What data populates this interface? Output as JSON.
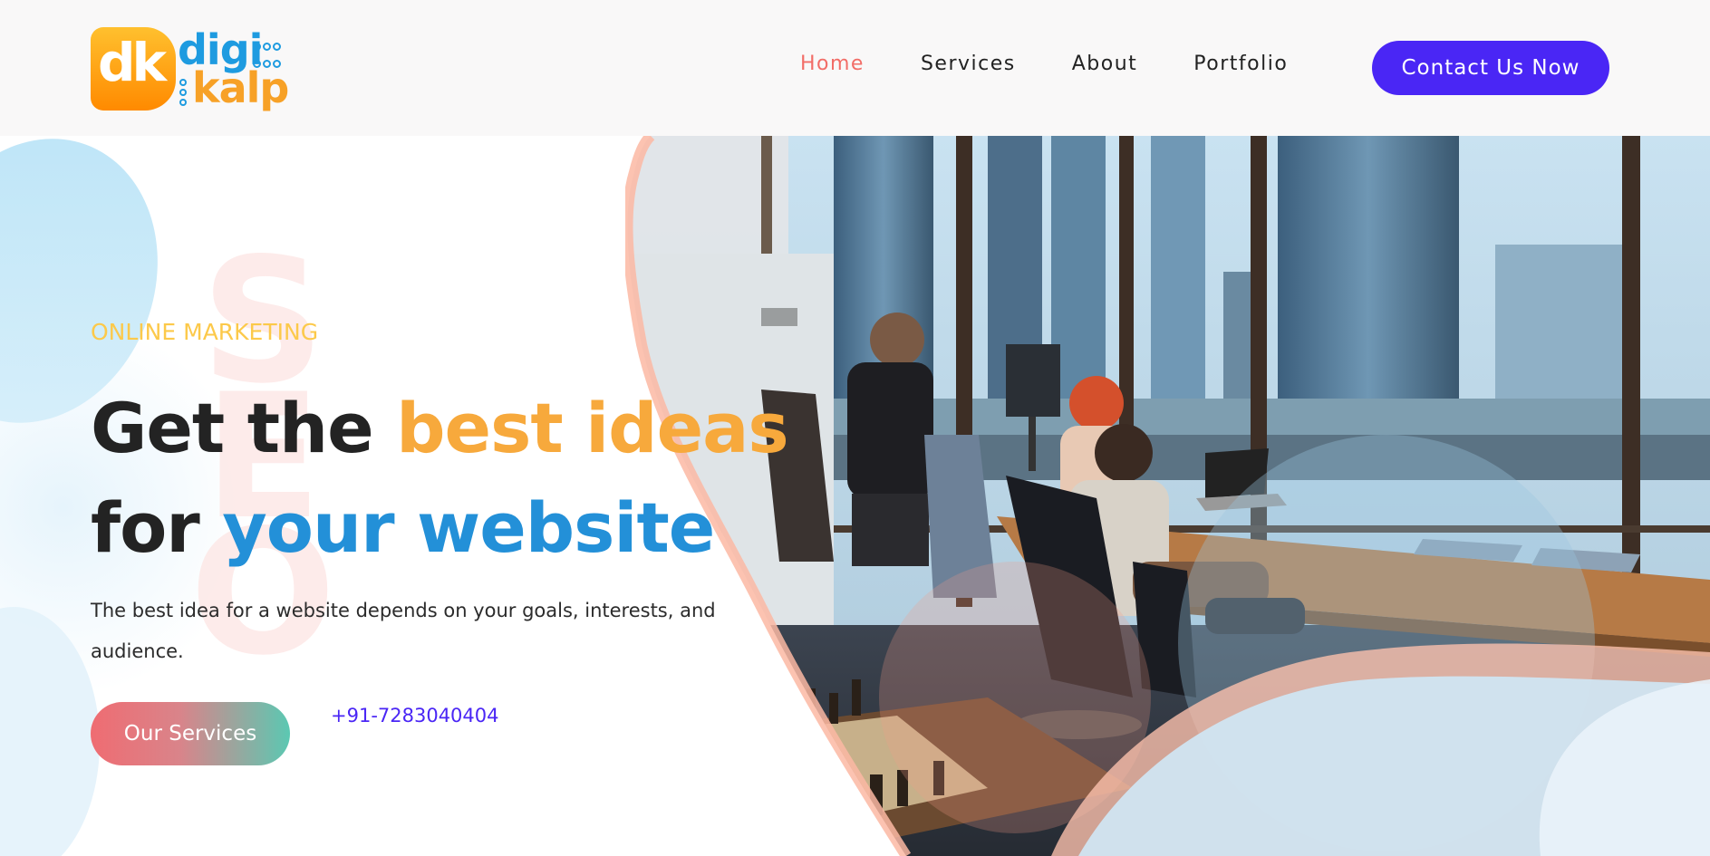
{
  "brand": {
    "logo_badge": "dk",
    "logo_line1": "digi",
    "logo_line2": "kalp",
    "colors": {
      "orange": "#f7a127",
      "blue": "#1e9be0"
    }
  },
  "nav": {
    "items": [
      {
        "label": "Home",
        "active": true
      },
      {
        "label": "Services",
        "active": false
      },
      {
        "label": "About",
        "active": false
      },
      {
        "label": "Portfolio",
        "active": false
      }
    ],
    "cta_label": "Contact Us Now"
  },
  "hero": {
    "background_text": "SEO",
    "eyebrow": "ONLINE MARKETING",
    "headline_part1": "Get the ",
    "headline_highlight1": "best ideas",
    "headline_part2": "for ",
    "headline_highlight2": "your website",
    "description": "The best idea for a website depends on your goals, interests, and audience.",
    "primary_button": "Our Services",
    "phone": "+91-7283040404",
    "image_subject": "office-coworking-photo"
  },
  "colors": {
    "accent_purple": "#4a26f5",
    "active_nav": "#f26d67",
    "eyebrow": "#fcc94a",
    "highlight_orange": "#f7a93c",
    "highlight_blue": "#2390d8"
  }
}
